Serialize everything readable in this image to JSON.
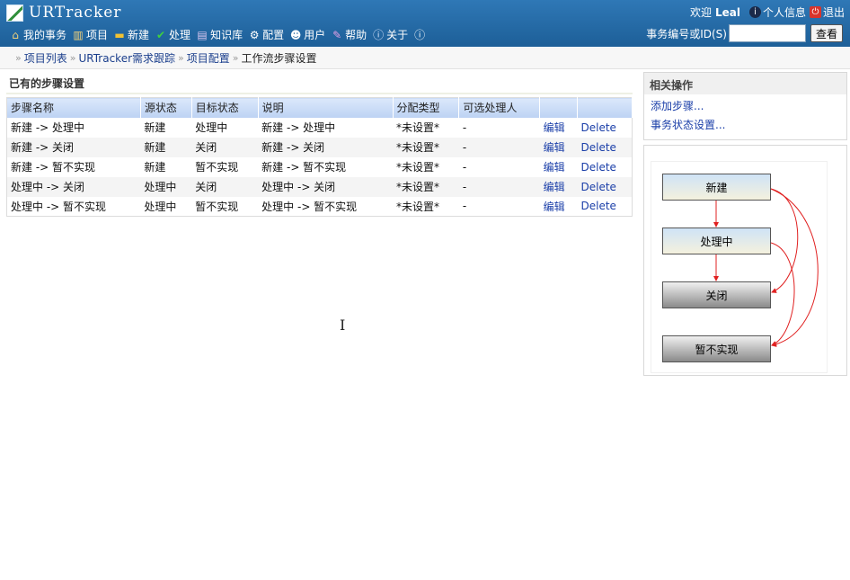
{
  "app": {
    "logo_text": "URTracker"
  },
  "nav": [
    {
      "label": "我的事务",
      "icon": "home-icon",
      "glyph": "⌂",
      "color": "#f3d37a"
    },
    {
      "label": "项目",
      "icon": "folders-icon",
      "glyph": "▥",
      "color": "#f3d37a"
    },
    {
      "label": "新建",
      "icon": "new-item-icon",
      "glyph": "▬",
      "color": "#f1c232"
    },
    {
      "label": "处理",
      "icon": "checkmark-icon",
      "glyph": "✔",
      "color": "#3fcf3f"
    },
    {
      "label": "知识库",
      "icon": "book-icon",
      "glyph": "▤",
      "color": "#d9c6f0"
    },
    {
      "label": "配置",
      "icon": "tools-icon",
      "glyph": "⚙",
      "color": "#ffffff"
    },
    {
      "label": "用户",
      "icon": "users-icon",
      "glyph": "☻",
      "color": "#ffffff"
    },
    {
      "label": "帮助",
      "icon": "help-book-icon",
      "glyph": "✎",
      "color": "#e6a0e6"
    },
    {
      "label": "关于",
      "icon": "info-icon",
      "glyph": "ⓘ",
      "color": "#dfe9ff"
    },
    {
      "label": "",
      "icon": "info-circle-icon",
      "glyph": "ⓘ",
      "color": "#ffffff"
    }
  ],
  "top_right": {
    "welcome": "欢迎",
    "username": "Leal",
    "profile_label": "个人信息",
    "logout_label": "退出"
  },
  "search": {
    "label": "事务编号或ID(S)",
    "value": "",
    "button": "查看"
  },
  "breadcrumb": [
    {
      "label": "项目列表",
      "link": true
    },
    {
      "label": "URTracker需求跟踪",
      "link": true
    },
    {
      "label": "项目配置",
      "link": true
    },
    {
      "label": "工作流步骤设置",
      "link": false
    }
  ],
  "main": {
    "title": "已有的步骤设置",
    "columns": [
      "步骤名称",
      "源状态",
      "目标状态",
      "说明",
      "分配类型",
      "可选处理人",
      "",
      ""
    ],
    "rows": [
      {
        "name": "新建  -> 处理中",
        "from": "新建",
        "to": "处理中",
        "desc": "新建  -> 处理中",
        "assign": "*未设置*",
        "handlers": "-",
        "edit": "编辑",
        "delete": "Delete"
      },
      {
        "name": "新建  -> 关闭",
        "from": "新建",
        "to": "关闭",
        "desc": "新建  -> 关闭",
        "assign": "*未设置*",
        "handlers": "-",
        "edit": "编辑",
        "delete": "Delete"
      },
      {
        "name": "新建  -> 暂不实现",
        "from": "新建",
        "to": "暂不实现",
        "desc": "新建  -> 暂不实现",
        "assign": "*未设置*",
        "handlers": "-",
        "edit": "编辑",
        "delete": "Delete"
      },
      {
        "name": "处理中  -> 关闭",
        "from": "处理中",
        "to": "关闭",
        "desc": "处理中  -> 关闭",
        "assign": "*未设置*",
        "handlers": "-",
        "edit": "编辑",
        "delete": "Delete"
      },
      {
        "name": "处理中  -> 暂不实现",
        "from": "处理中",
        "to": "暂不实现",
        "desc": "处理中  -> 暂不实现",
        "assign": "*未设置*",
        "handlers": "-",
        "edit": "编辑",
        "delete": "Delete"
      }
    ]
  },
  "side": {
    "ops_title": "相关操作",
    "ops_links": [
      "添加步骤...",
      "事务状态设置..."
    ],
    "flow_nodes": [
      "新建",
      "处理中",
      "关闭",
      "暂不实现"
    ]
  },
  "colors": {
    "header_blue": "#2f78b6",
    "link_blue": "#1a3ea8",
    "arrow_red": "#e02020"
  }
}
